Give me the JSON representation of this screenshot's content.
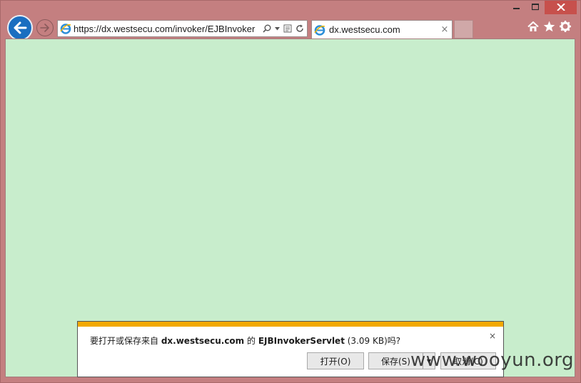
{
  "browser": {
    "address_url": "https://dx.westsecu.com/invoker/EJBInvoker",
    "tab_title": "dx.westsecu.com",
    "tab_close": "×"
  },
  "icons": {
    "back": "back-arrow-icon",
    "forward": "forward-arrow-icon",
    "ie": "ie-logo-icon",
    "search": "search-icon",
    "dropdown": "dropdown-arrow-icon",
    "compat": "compatibility-view-icon",
    "refresh": "refresh-icon",
    "home": "home-icon",
    "favorites": "star-icon",
    "tools": "gear-icon"
  },
  "colors": {
    "frame": "#c47f80",
    "page_background": "#c8edcc",
    "notification_accent": "#f2a900",
    "back_button": "#1a6ec0"
  },
  "download_bar": {
    "prefix": "要打开或保存来自 ",
    "site": "dx.westsecu.com",
    "middle": " 的 ",
    "filename": "EJBInvokerServlet",
    "suffix": " (3.09 KB)吗?",
    "close": "×",
    "open_label": "打开(O)",
    "save_label": "保存(S)",
    "save_arrow": "▾",
    "cancel_label": "取消(C)"
  },
  "watermark": "www.wooyun.org"
}
